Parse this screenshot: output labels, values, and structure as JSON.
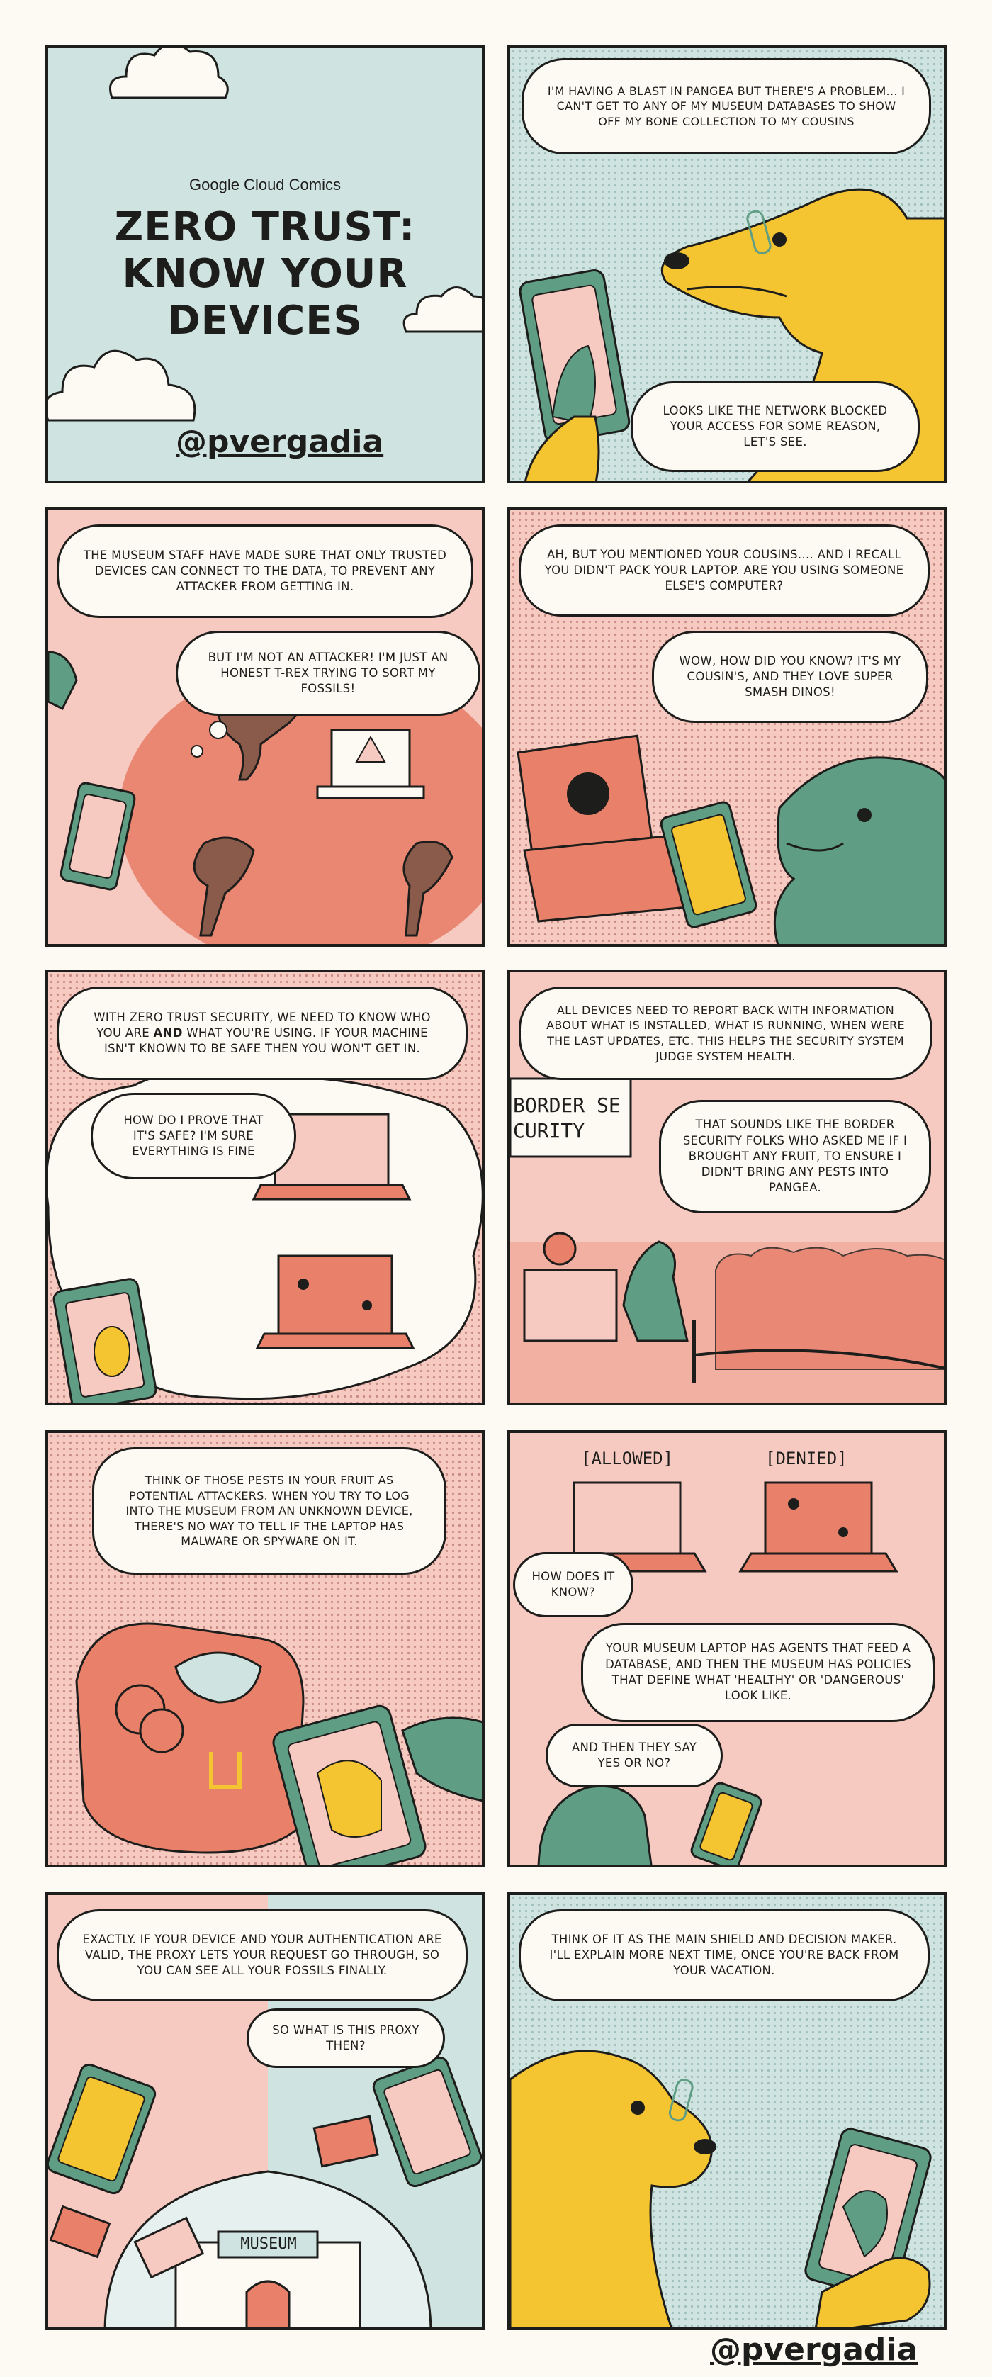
{
  "colors": {
    "ink": "#1d1d1b",
    "paper": "#fdfaf4",
    "blue": "#cfe3e0",
    "pink": "#f6c9c1",
    "coral": "#e8806a",
    "green": "#5f9e85",
    "yellow": "#f5c431"
  },
  "panel1": {
    "brand": "Google Cloud Comics",
    "title_line1": "ZERO TRUST:",
    "title_line2": "KNOW YOUR",
    "title_line3": "DEVICES",
    "handle": "@pvergadia"
  },
  "panel2": {
    "bubble1": "I'm having a blast in Pangea but there's a problem... I can't get to any of my museum databases to show off my bone collection to my cousins",
    "bubble2": "Looks like the network blocked your access for some reason, let's see."
  },
  "panel3": {
    "bubble1": "The museum staff have made sure that only trusted devices can connect to the data, to prevent any attacker from getting in.",
    "bubble2": "But I'm not an attacker! I'm just an honest T-Rex trying to sort my fossils!"
  },
  "panel4": {
    "bubble1": "Ah, but you mentioned your cousins.... and I recall you didn't pack your laptop. Are you using someone else's computer?",
    "bubble2": "Wow, how did you know? It's my cousin's, and they love Super Smash Dinos!"
  },
  "panel5": {
    "bubble1_a": "With zero trust security, we need to know who you are",
    "bubble1_and": "and",
    "bubble1_b": "what you're using. If your machine isn't known to be safe then you won't get in.",
    "bubble2": "How do I prove that it's safe? I'm sure everything is fine"
  },
  "panel6": {
    "bubble1": "All devices need to report back with information about what is installed, what is running, when were the last updates, etc. This helps the security system judge system health.",
    "bubble2": "That sounds like the border security folks who asked me if I brought any fruit, to ensure I didn't bring any pests into Pangea.",
    "sign": "BORDER SECURITY"
  },
  "panel7": {
    "bubble1": "Think of those pests in your fruit as potential attackers. When you try to log into the museum from an unknown device, there's no way to tell if the laptop has malware or spyware on it."
  },
  "panel8": {
    "label_allowed": "[ALLOWED]",
    "label_denied": "[DENIED]",
    "bubble1": "How does it know?",
    "bubble2": "Your museum laptop has agents that feed a database, and then the museum has policies that define what 'healthy' or 'dangerous' look like.",
    "bubble3": "And then they say yes or no?"
  },
  "panel9": {
    "bubble1": "Exactly. If your device and your authentication are valid, the proxy lets your request go through, so you can see all your fossils finally.",
    "bubble2": "So what is this proxy then?",
    "museum_sign": "MUSEUM"
  },
  "panel10": {
    "bubble1": "Think of it as the main shield and decision maker. I'll explain more next time, once you're back from your vacation."
  },
  "footer": {
    "handle": "@pvergadia"
  }
}
